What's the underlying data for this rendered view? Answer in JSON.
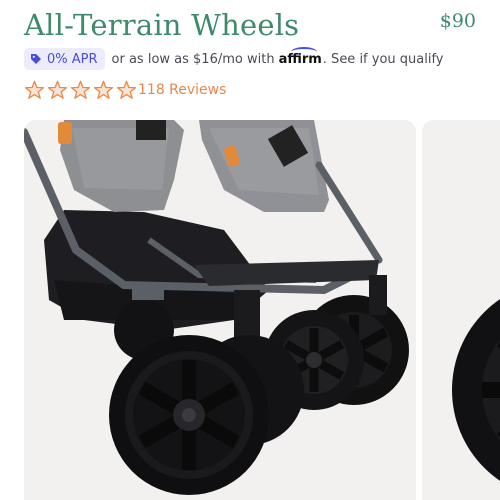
{
  "product": {
    "title": "All-Terrain Wheels",
    "price": "$90"
  },
  "financing": {
    "badge_label": "0% APR",
    "text_before_logo": "or as low as $16/mo with",
    "logo_text": "affirm",
    "text_after_logo": ". See if you qualify"
  },
  "rating": {
    "stars": 5,
    "reviews_label": "118 Reviews"
  },
  "colors": {
    "title": "#3f8a6b",
    "badge_bg": "#ececfd",
    "badge_text": "#4a4ae0",
    "stars": "#e8874a",
    "reviews_link": "#e8874a"
  },
  "icons": {
    "badge": "tag-icon",
    "rating": "star-icon"
  }
}
